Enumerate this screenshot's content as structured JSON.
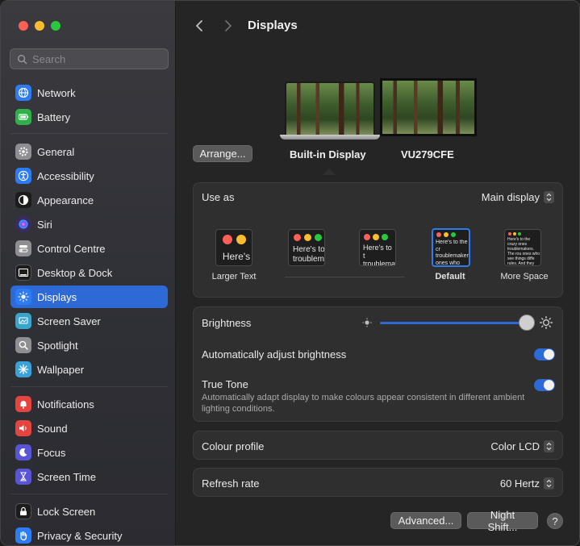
{
  "window": {
    "traffic_lights": [
      "close",
      "minimize",
      "zoom"
    ]
  },
  "sidebar": {
    "search_placeholder": "Search",
    "items": [
      {
        "label": "Network",
        "icon": "globe-icon",
        "color": "#2d7cf6"
      },
      {
        "label": "Battery",
        "icon": "battery-icon",
        "color": "#2fb04b"
      },
      {
        "label": "General",
        "icon": "gear-icon",
        "color": "#8e8e93"
      },
      {
        "label": "Accessibility",
        "icon": "accessibility-icon",
        "color": "#2d7cf6"
      },
      {
        "label": "Appearance",
        "icon": "appearance-icon",
        "color": "#1c1c1c"
      },
      {
        "label": "Siri",
        "icon": "siri-icon",
        "color": "#3a2a66"
      },
      {
        "label": "Control Centre",
        "icon": "control-centre-icon",
        "color": "#8e8e93"
      },
      {
        "label": "Desktop & Dock",
        "icon": "dock-icon",
        "color": "#1c1c1c"
      },
      {
        "label": "Displays",
        "icon": "sun-icon",
        "color": "#2d7cf6",
        "selected": true
      },
      {
        "label": "Screen Saver",
        "icon": "screen-saver-icon",
        "color": "#39a6c9"
      },
      {
        "label": "Spotlight",
        "icon": "magnifier-icon",
        "color": "#8e8e93"
      },
      {
        "label": "Wallpaper",
        "icon": "flower-icon",
        "color": "#38a1d8"
      },
      {
        "label": "Notifications",
        "icon": "bell-icon",
        "color": "#e5453f"
      },
      {
        "label": "Sound",
        "icon": "speaker-icon",
        "color": "#e5453f"
      },
      {
        "label": "Focus",
        "icon": "moon-icon",
        "color": "#5856d6"
      },
      {
        "label": "Screen Time",
        "icon": "hourglass-icon",
        "color": "#5856d6"
      },
      {
        "label": "Lock Screen",
        "icon": "lock-icon",
        "color": "#1c1c1c"
      },
      {
        "label": "Privacy & Security",
        "icon": "hand-icon",
        "color": "#2d7cf6"
      }
    ]
  },
  "header": {
    "title": "Displays"
  },
  "arrangement": {
    "arrange_button": "Arrange...",
    "displays": [
      {
        "label": "Built-in Display",
        "selected": true
      },
      {
        "label": "VU279CFE"
      }
    ]
  },
  "use_as": {
    "label": "Use as",
    "value": "Main display",
    "resolutions": [
      {
        "label": "Larger Text",
        "sample": "Here's"
      },
      {
        "label": "",
        "sample": "Here's to troublem"
      },
      {
        "label": "",
        "sample": "Here's to t troublema ones who"
      },
      {
        "label": "Default",
        "sample": "Here's to the cr troublemakers. ones who see th rules. And they",
        "selected": true
      },
      {
        "label": "More Space",
        "sample": "Here's to the crazy ones troublemakers. The rou ones who see things diffe rules. And they have no can quote them, disagr them. About the only thi"
      }
    ]
  },
  "brightness": {
    "label": "Brightness",
    "level": 0.95,
    "auto_label": "Automatically adjust brightness",
    "auto_enabled": true,
    "true_tone_label": "True Tone",
    "true_tone_desc": "Automatically adapt display to make colours appear consistent in different ambient lighting conditions.",
    "true_tone_enabled": true
  },
  "colour_profile": {
    "label": "Colour profile",
    "value": "Color LCD"
  },
  "refresh_rate": {
    "label": "Refresh rate",
    "value": "60 Hertz"
  },
  "footer": {
    "advanced_button": "Advanced...",
    "night_shift_button": "Night Shift...",
    "help_label": "?"
  },
  "colors": {
    "accent": "#2d6ad6",
    "selected_sidebar": "#2d6ad6"
  }
}
